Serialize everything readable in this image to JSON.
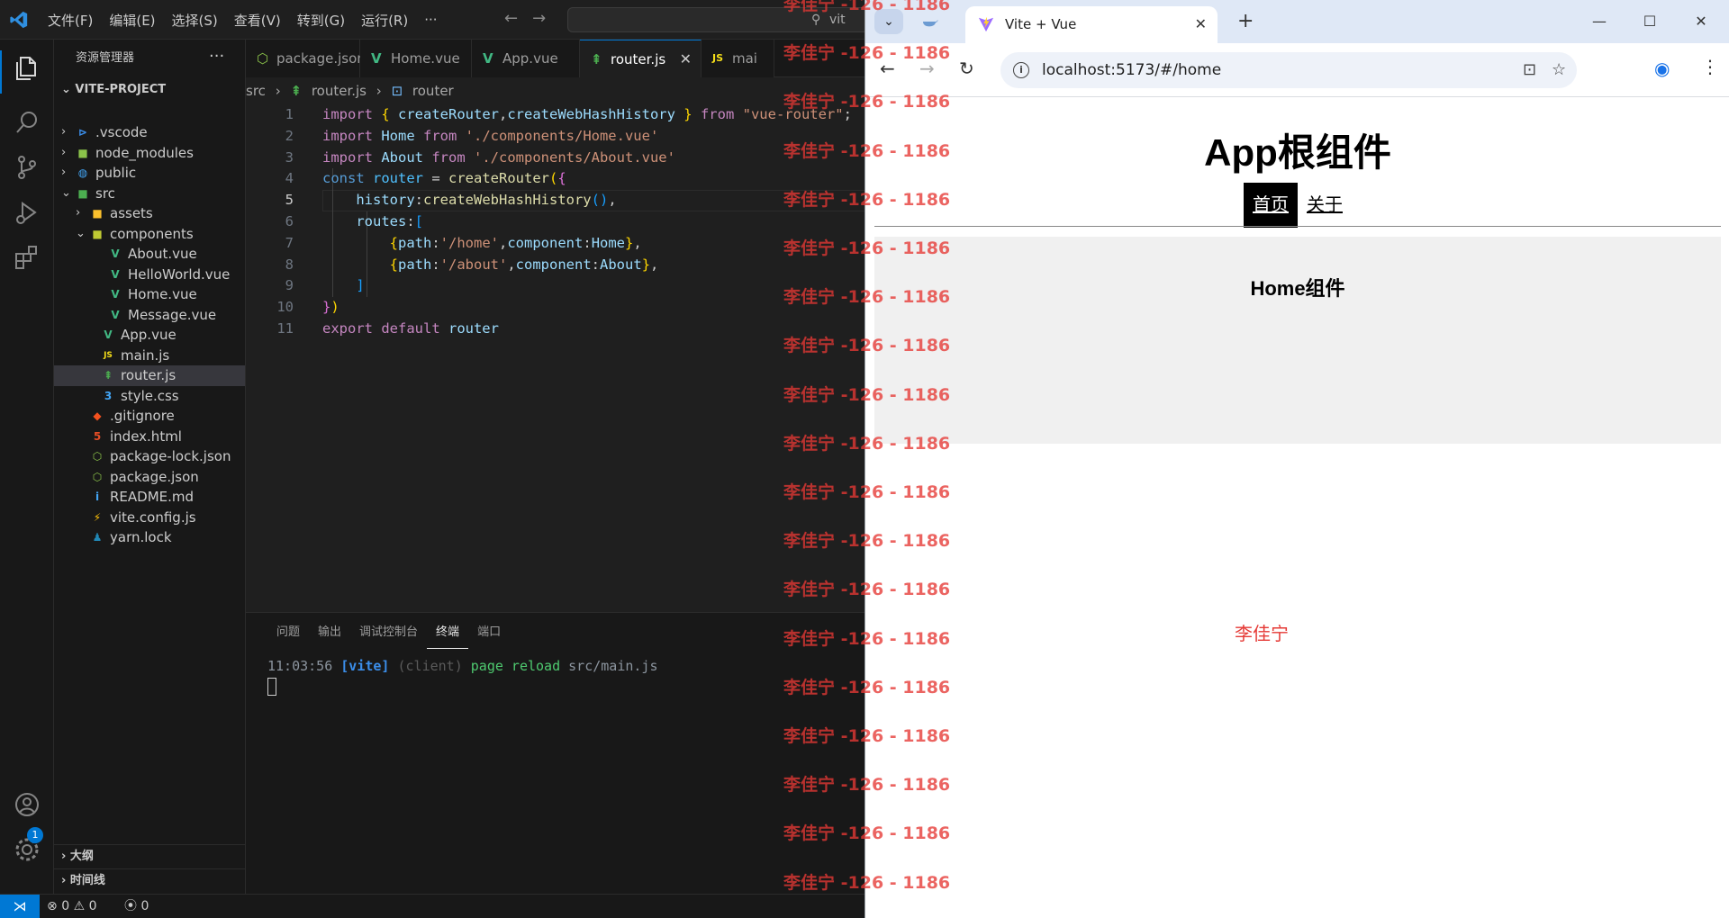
{
  "vscode": {
    "menu": [
      "文件(F)",
      "编辑(E)",
      "选择(S)",
      "查看(V)",
      "转到(G)",
      "运行(R)",
      "···"
    ],
    "command_center": "vit",
    "explorer_title": "资源管理器",
    "explorer_more": "···",
    "project_name": "VITE-PROJECT",
    "tree": [
      {
        "label": ".vscode",
        "icon": "vscode-folder-icon",
        "glyph": "⊳",
        "color": "#3b8eea",
        "depth": 1,
        "chev": "›"
      },
      {
        "label": "node_modules",
        "icon": "node-folder-icon",
        "glyph": "■",
        "color": "#8bc34a",
        "depth": 1,
        "chev": "›"
      },
      {
        "label": "public",
        "icon": "globe-folder-icon",
        "glyph": "◍",
        "color": "#42a5f5",
        "depth": 1,
        "chev": "›"
      },
      {
        "label": "src",
        "icon": "src-folder-icon",
        "glyph": "■",
        "color": "#4caf50",
        "depth": 1,
        "chev": "⌄"
      },
      {
        "label": "assets",
        "icon": "assets-folder-icon",
        "glyph": "■",
        "color": "#fbc02d",
        "depth": 2,
        "chev": "›"
      },
      {
        "label": "components",
        "icon": "components-folder-icon",
        "glyph": "■",
        "color": "#c0ca33",
        "depth": 2,
        "chev": "⌄"
      },
      {
        "label": "About.vue",
        "icon": "vue-file-icon",
        "glyph": "V",
        "color": "#41b883",
        "depth": 4,
        "chev": ""
      },
      {
        "label": "HelloWorld.vue",
        "icon": "vue-file-icon",
        "glyph": "V",
        "color": "#41b883",
        "depth": 4,
        "chev": ""
      },
      {
        "label": "Home.vue",
        "icon": "vue-file-icon",
        "glyph": "V",
        "color": "#41b883",
        "depth": 4,
        "chev": ""
      },
      {
        "label": "Message.vue",
        "icon": "vue-file-icon",
        "glyph": "V",
        "color": "#41b883",
        "depth": 4,
        "chev": ""
      },
      {
        "label": "App.vue",
        "icon": "vue-file-icon",
        "glyph": "V",
        "color": "#41b883",
        "depth": 3,
        "chev": ""
      },
      {
        "label": "main.js",
        "icon": "js-file-icon",
        "glyph": "JS",
        "color": "#f5de19",
        "depth": 3,
        "chev": ""
      },
      {
        "label": "router.js",
        "icon": "router-file-icon",
        "glyph": "⇞",
        "color": "#4caf50",
        "depth": 3,
        "chev": "",
        "selected": true
      },
      {
        "label": "style.css",
        "icon": "css-file-icon",
        "glyph": "3",
        "color": "#42a5f5",
        "depth": 3,
        "chev": ""
      },
      {
        "label": ".gitignore",
        "icon": "git-file-icon",
        "glyph": "◆",
        "color": "#f4511e",
        "depth": 2,
        "chev": ""
      },
      {
        "label": "index.html",
        "icon": "html-file-icon",
        "glyph": "5",
        "color": "#e44d26",
        "depth": 2,
        "chev": ""
      },
      {
        "label": "package-lock.json",
        "icon": "node-file-icon",
        "glyph": "⬡",
        "color": "#8bc34a",
        "depth": 2,
        "chev": ""
      },
      {
        "label": "package.json",
        "icon": "node-file-icon",
        "glyph": "⬡",
        "color": "#8bc34a",
        "depth": 2,
        "chev": ""
      },
      {
        "label": "README.md",
        "icon": "info-file-icon",
        "glyph": "i",
        "color": "#42a5f5",
        "depth": 2,
        "chev": ""
      },
      {
        "label": "vite.config.js",
        "icon": "vite-file-icon",
        "glyph": "⚡",
        "color": "#ffc107",
        "depth": 2,
        "chev": ""
      },
      {
        "label": "yarn.lock",
        "icon": "yarn-file-icon",
        "glyph": "♟",
        "color": "#2188b6",
        "depth": 2,
        "chev": ""
      }
    ],
    "outline_label": "大纲",
    "timeline_label": "时间线",
    "activity_badge": "1",
    "tabs": [
      {
        "label": "package.json",
        "icon": "node-file-icon",
        "glyph": "⬡",
        "color": "#8bc34a"
      },
      {
        "label": "Home.vue",
        "icon": "vue-file-icon",
        "glyph": "V",
        "color": "#41b883"
      },
      {
        "label": "App.vue",
        "icon": "vue-file-icon",
        "glyph": "V",
        "color": "#41b883"
      },
      {
        "label": "router.js",
        "icon": "router-file-icon",
        "glyph": "⇞",
        "color": "#4caf50",
        "active": true
      },
      {
        "label": "mai",
        "icon": "js-file-icon",
        "glyph": "JS",
        "color": "#f5de19"
      }
    ],
    "tab_close": "✕",
    "breadcrumb": {
      "folder": "src",
      "sep": "›",
      "file": "router.js",
      "symbol": "router"
    },
    "code_lines": [
      [
        [
          "kw",
          "import "
        ],
        [
          "b1",
          "{ "
        ],
        [
          "vr",
          "createRouter"
        ],
        [
          "pl",
          ","
        ],
        [
          "vr",
          "createWebHashHistory"
        ],
        [
          "b1",
          " } "
        ],
        [
          "kw",
          "from "
        ],
        [
          "st",
          "\"vue-router\""
        ],
        [
          "pl",
          ";"
        ]
      ],
      [
        [
          "kw",
          "import "
        ],
        [
          "vr",
          "Home "
        ],
        [
          "kw",
          "from "
        ],
        [
          "st",
          "'./components/Home.vue'"
        ]
      ],
      [
        [
          "kw",
          "import "
        ],
        [
          "vr",
          "About "
        ],
        [
          "kw",
          "from "
        ],
        [
          "st",
          "'./components/About.vue'"
        ]
      ],
      [
        [
          "kd",
          "const "
        ],
        [
          "cn",
          "router "
        ],
        [
          "pl",
          "= "
        ],
        [
          "fn",
          "createRouter"
        ],
        [
          "b1",
          "("
        ],
        [
          "b2",
          "{"
        ]
      ],
      [
        [
          "pl",
          "    "
        ],
        [
          "vr",
          "history"
        ],
        [
          "pl",
          ":"
        ],
        [
          "fn",
          "createWebHashHistory"
        ],
        [
          "b3",
          "()"
        ],
        [
          "pl",
          ","
        ]
      ],
      [
        [
          "pl",
          "    "
        ],
        [
          "vr",
          "routes"
        ],
        [
          "pl",
          ":"
        ],
        [
          "b3",
          "["
        ]
      ],
      [
        [
          "pl",
          "        "
        ],
        [
          "b1",
          "{"
        ],
        [
          "vr",
          "path"
        ],
        [
          "pl",
          ":"
        ],
        [
          "st",
          "'/home'"
        ],
        [
          "pl",
          ","
        ],
        [
          "vr",
          "component"
        ],
        [
          "pl",
          ":"
        ],
        [
          "vr",
          "Home"
        ],
        [
          "b1",
          "}"
        ],
        [
          "pl",
          ","
        ]
      ],
      [
        [
          "pl",
          "        "
        ],
        [
          "b1",
          "{"
        ],
        [
          "vr",
          "path"
        ],
        [
          "pl",
          ":"
        ],
        [
          "st",
          "'/about'"
        ],
        [
          "pl",
          ","
        ],
        [
          "vr",
          "component"
        ],
        [
          "pl",
          ":"
        ],
        [
          "vr",
          "About"
        ],
        [
          "b1",
          "}"
        ],
        [
          "pl",
          ","
        ]
      ],
      [
        [
          "pl",
          "    "
        ],
        [
          "b3",
          "]"
        ]
      ],
      [
        [
          "b2",
          "}"
        ],
        [
          "b1",
          ")"
        ]
      ],
      [
        [
          "kw",
          "export "
        ],
        [
          "kw",
          "default "
        ],
        [
          "vr",
          "router"
        ]
      ]
    ],
    "current_line": 5,
    "panel_tabs": [
      "问题",
      "输出",
      "调试控制台",
      "终端",
      "端口"
    ],
    "active_panel_tab": "终端",
    "terminal_line": [
      [
        "#8b949e",
        "11:03:56 "
      ],
      [
        "#3b8eea",
        "[vite] "
      ],
      [
        "#5a5a5a",
        "(client) "
      ],
      [
        "#4ec96f",
        "page reload "
      ],
      [
        "#8b949e",
        "src/main.js"
      ]
    ],
    "status": {
      "errors": "0",
      "warnings": "0",
      "ports": "0"
    }
  },
  "chrome": {
    "tab_title": "Vite + Vue",
    "url": "localhost:5173/#/home",
    "page": {
      "heading": "App根组件",
      "nav": [
        "首页",
        "关于"
      ],
      "active_nav": "首页",
      "view_heading": "Home组件",
      "signature": "李佳宁"
    }
  },
  "watermark": {
    "text": "李佳宁 -126 - 1186"
  },
  "colors": {
    "accent": "#0078d4",
    "watermark": "#e53935"
  }
}
